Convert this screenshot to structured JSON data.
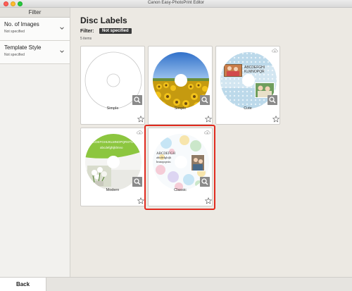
{
  "window": {
    "title": "Canon Easy-PhotoPrint Editor"
  },
  "sidebar": {
    "header": "Filter",
    "items": [
      {
        "label": "No. of Images",
        "value": "Not specified"
      },
      {
        "label": "Template Style",
        "value": "Not specified"
      }
    ]
  },
  "main": {
    "title": "Disc Labels",
    "filter_label": "Filter:",
    "filter_value": "Not specified",
    "count": "5 items"
  },
  "templates": [
    {
      "label": "Simple",
      "style": "blank"
    },
    {
      "label": "Simple",
      "style": "sunflower"
    },
    {
      "label": "Cute",
      "style": "polka-dots",
      "disc_text": [
        "ABCDEFGHI",
        "KLMNOPQR"
      ]
    },
    {
      "label": "Modern",
      "style": "green-flower",
      "disc_text": [
        "ABCDEFGHIJKLMNOPQRSTUV",
        "abcdefghijklmno"
      ]
    },
    {
      "label": "Classic",
      "style": "watercolor",
      "selected": true,
      "disc_text": [
        "ABCDEFGH",
        "abcdefghijk",
        "lmnopqrstu"
      ]
    }
  ],
  "footer": {
    "back_label": "Back"
  },
  "colors": {
    "selection": "#e02b1f",
    "accent": "#3a3a3a"
  }
}
